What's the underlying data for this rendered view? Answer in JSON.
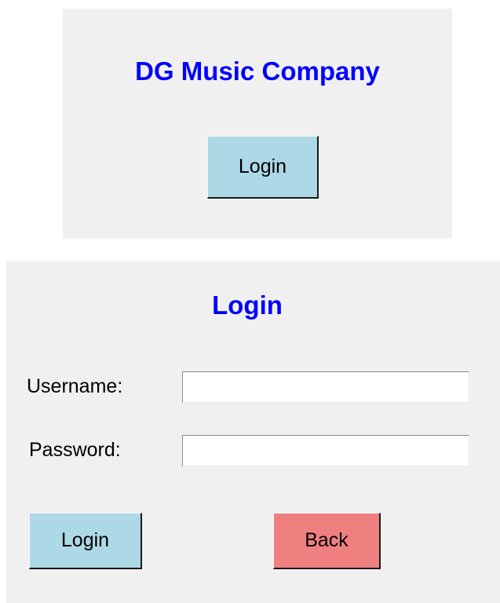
{
  "home_window": {
    "title": "DG Music Company",
    "login_button_label": "Login"
  },
  "login_window": {
    "title": "Login",
    "username_label": "Username:",
    "username_value": "",
    "password_label": "Password:",
    "password_value": "",
    "login_button_label": "Login",
    "back_button_label": "Back"
  },
  "colors": {
    "title_color": "#0000ff",
    "panel_background": "#f0f0f0",
    "login_button_background": "#add8e6",
    "back_button_background": "#f08080"
  }
}
